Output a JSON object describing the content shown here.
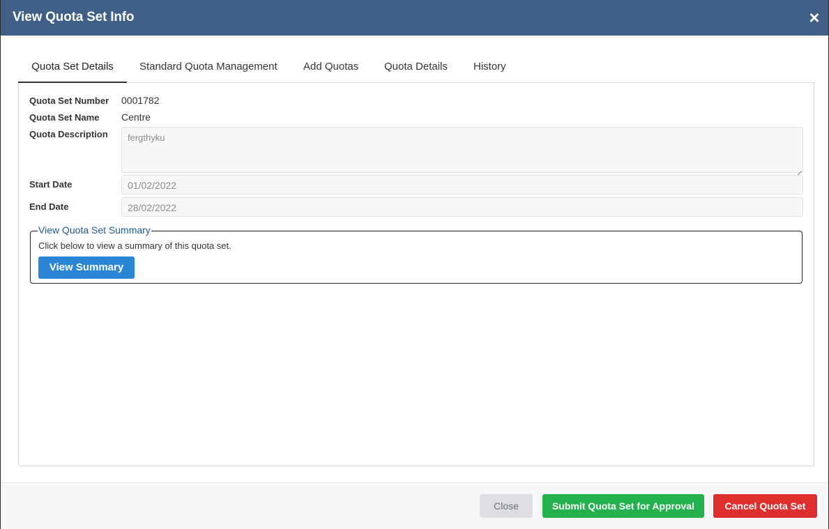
{
  "modal": {
    "title": "View Quota Set Info",
    "close_icon": "×"
  },
  "tabs": [
    {
      "label": "Quota Set Details",
      "active": true
    },
    {
      "label": "Standard Quota Management",
      "active": false
    },
    {
      "label": "Add Quotas",
      "active": false
    },
    {
      "label": "Quota Details",
      "active": false
    },
    {
      "label": "History",
      "active": false
    }
  ],
  "details": {
    "number_label": "Quota Set Number",
    "number_value": "0001782",
    "name_label": "Quota Set Name",
    "name_value": "Centre",
    "description_label": "Quota Description",
    "description_value": "fergthyku",
    "start_label": "Start Date",
    "start_value": "01/02/2022",
    "end_label": "End Date",
    "end_value": "28/02/2022"
  },
  "summary": {
    "legend": "View Quota Set Summary",
    "text": "Click below to view a summary of this quota set.",
    "button": "View Summary"
  },
  "footer": {
    "close": "Close",
    "submit": "Submit Quota Set for Approval",
    "cancel": "Cancel Quota Set"
  },
  "colors": {
    "header": "#3f5f86",
    "primary": "#2a86d4",
    "success": "#22b14c",
    "danger": "#df2e2e",
    "legend": "#1f5d8f"
  }
}
